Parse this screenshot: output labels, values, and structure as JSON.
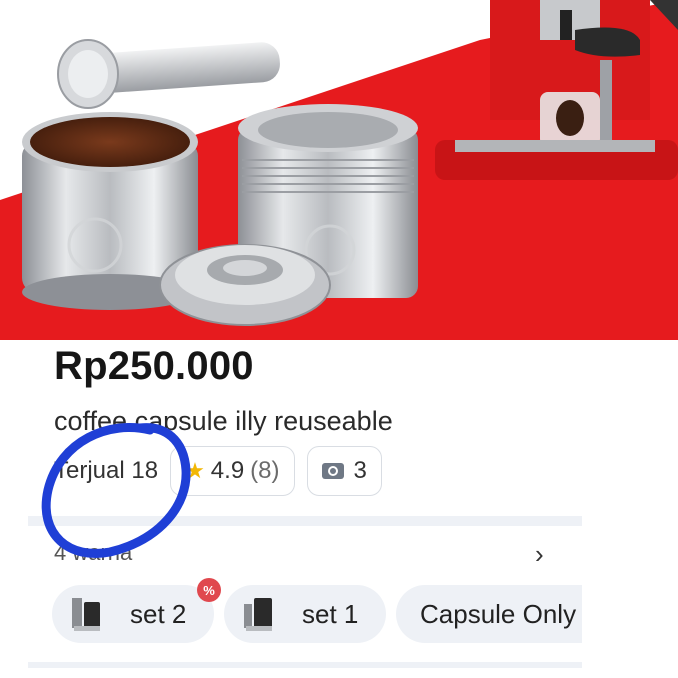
{
  "product": {
    "price": "Rp250.000",
    "title": "coffee capsule illy reuseable",
    "sold": "Terjual 18",
    "rating": "4.9",
    "rating_count": "(8)",
    "photo_count": "3"
  },
  "variants": {
    "label": "4 warna",
    "options": [
      {
        "label": "set 2",
        "badge": "%"
      },
      {
        "label": "set 1"
      },
      {
        "label": "Capsule Only"
      }
    ]
  },
  "icons": {
    "star": "star-icon",
    "camera": "camera-icon",
    "chevron": "chevron-right-icon",
    "badge": "discount-badge-icon"
  },
  "colors": {
    "accent_red": "#e61b1e",
    "scribble_blue": "#1f3fd6",
    "star_yellow": "#f2b705",
    "chip_bg": "#eef1f6"
  }
}
